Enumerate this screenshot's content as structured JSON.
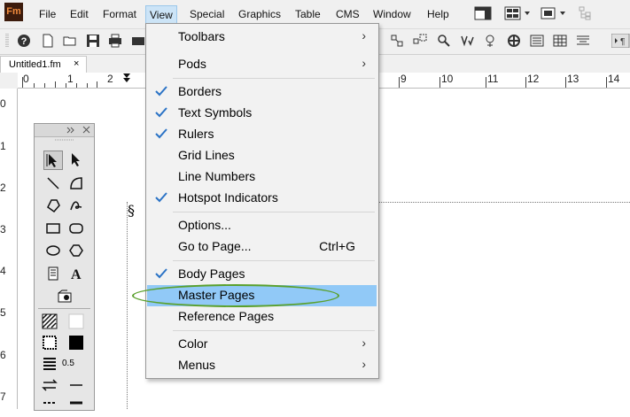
{
  "app": {
    "logo": "Fm"
  },
  "menubar": {
    "items": [
      {
        "label": "File"
      },
      {
        "label": "Edit"
      },
      {
        "label": "Format"
      },
      {
        "label": "View"
      },
      {
        "label": "Special"
      },
      {
        "label": "Graphics"
      },
      {
        "label": "Table"
      },
      {
        "label": "CMS"
      },
      {
        "label": "Window"
      },
      {
        "label": "Help"
      }
    ],
    "active": "View"
  },
  "document_tab": {
    "title": "Untitled1.fm",
    "close": "×"
  },
  "rulers": {
    "horizontal": [
      "0",
      "1",
      "2",
      "9",
      "10",
      "11",
      "12",
      "13",
      "14"
    ],
    "vertical": [
      "0",
      "1",
      "2",
      "3",
      "4",
      "5",
      "6",
      "7"
    ]
  },
  "palette": {
    "line_width": "0.5"
  },
  "view_menu": {
    "items": [
      {
        "label": "Toolbars",
        "checked": false,
        "submenu": true
      },
      {
        "label": "Pods",
        "checked": false,
        "submenu": true
      },
      {
        "label": "Borders",
        "checked": true
      },
      {
        "label": "Text Symbols",
        "checked": true
      },
      {
        "label": "Rulers",
        "checked": true
      },
      {
        "label": "Grid Lines",
        "checked": false
      },
      {
        "label": "Line Numbers",
        "checked": false
      },
      {
        "label": "Hotspot Indicators",
        "checked": true
      },
      {
        "label": "Options...",
        "checked": false
      },
      {
        "label": "Go to Page...",
        "checked": false,
        "shortcut": "Ctrl+G"
      },
      {
        "label": "Body Pages",
        "checked": true
      },
      {
        "label": "Master Pages",
        "checked": false,
        "highlighted": true
      },
      {
        "label": "Reference Pages",
        "checked": false
      },
      {
        "label": "Color",
        "checked": false,
        "submenu": true
      },
      {
        "label": "Menus",
        "checked": false,
        "submenu": true
      }
    ]
  },
  "colors": {
    "highlight": "#91c9f7",
    "annotation_oval": "#5aa02c",
    "check": "#2b73c6"
  }
}
